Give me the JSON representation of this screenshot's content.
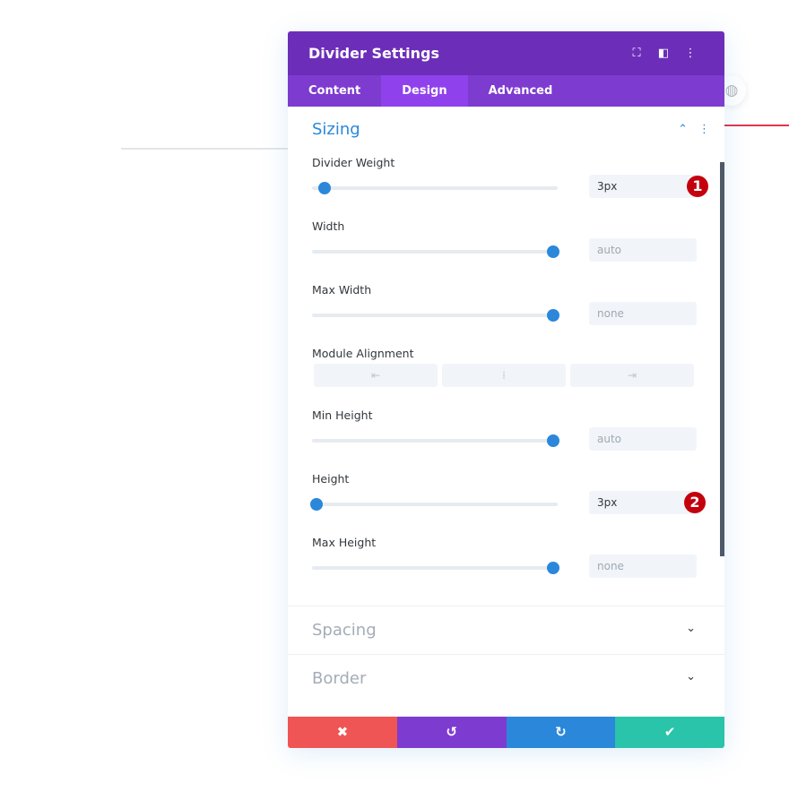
{
  "header": {
    "title": "Divider Settings"
  },
  "tabs": [
    {
      "label": "Content"
    },
    {
      "label": "Design"
    },
    {
      "label": "Advanced"
    }
  ],
  "section": {
    "title": "Sizing"
  },
  "fields": [
    {
      "label": "Divider Weight",
      "value": "3px",
      "slider_percent": 5,
      "badge": "1"
    },
    {
      "label": "Width",
      "value": "auto",
      "slider_percent": 98
    },
    {
      "label": "Max Width",
      "value": "none",
      "slider_percent": 98
    },
    {
      "label": "Module Alignment"
    },
    {
      "label": "Min Height",
      "value": "auto",
      "slider_percent": 98
    },
    {
      "label": "Height",
      "value": "3px",
      "slider_percent": 2,
      "badge": "2"
    },
    {
      "label": "Max Height",
      "value": "none",
      "slider_percent": 98
    }
  ],
  "collapsed": [
    {
      "title": "Spacing"
    },
    {
      "title": "Border"
    }
  ],
  "colors": {
    "header": "#6c2eb9",
    "tabs": "#7d3bcf",
    "accent": "#2b87da",
    "cancel": "#ef5555",
    "undo": "#7e3bd0",
    "redo": "#2b87da",
    "save": "#29c4a9"
  }
}
